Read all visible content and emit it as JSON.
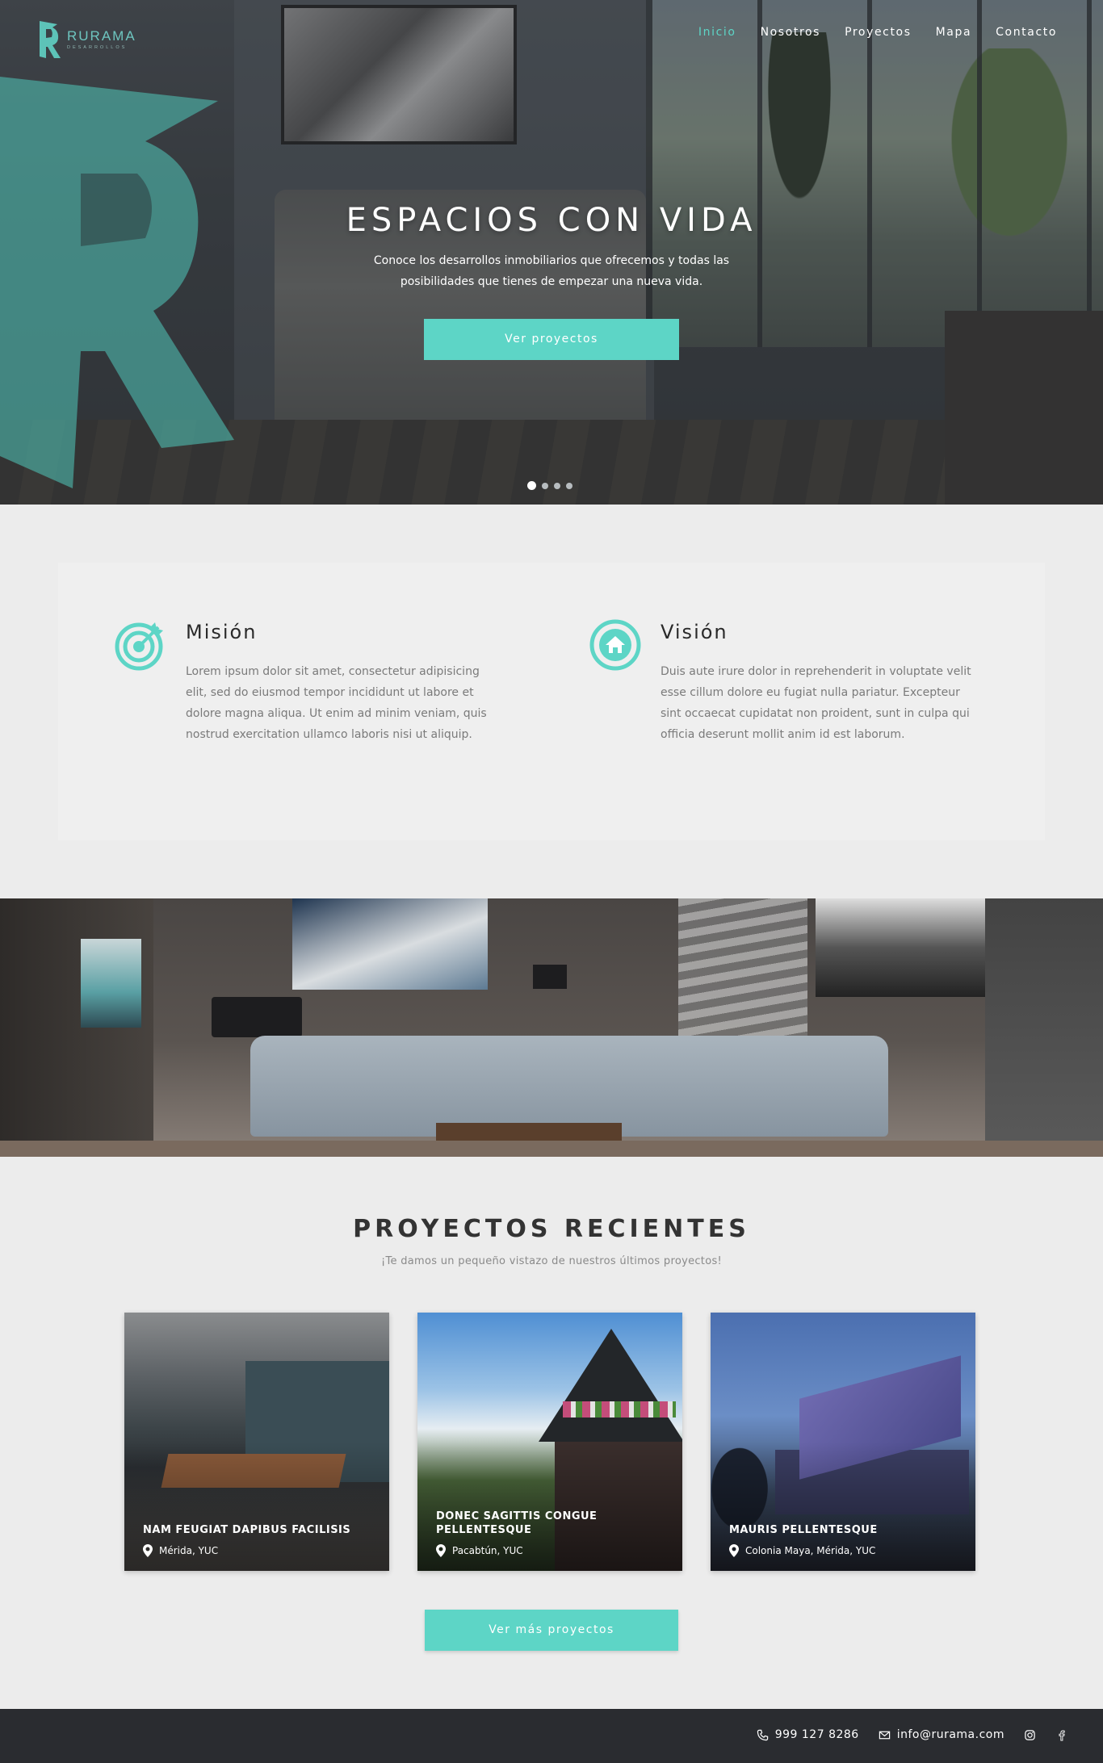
{
  "brand": {
    "name": "RURAMA",
    "tagline": "DESARROLLOS"
  },
  "nav": [
    {
      "label": "Inicio",
      "active": true
    },
    {
      "label": "Nosotros",
      "active": false
    },
    {
      "label": "Proyectos",
      "active": false
    },
    {
      "label": "Mapa",
      "active": false
    },
    {
      "label": "Contacto",
      "active": false
    }
  ],
  "hero": {
    "title": "ESPACIOS CON VIDA",
    "subtitle": "Conoce los desarrollos inmobiliarios que ofrecemos y todas las posibilidades que tienes de empezar una nueva vida.",
    "cta": "Ver proyectos",
    "slides": 4,
    "active_slide": 1
  },
  "mission": {
    "title": "Misión",
    "icon": "target-icon",
    "text": "Lorem ipsum dolor sit amet, consectetur adipisicing elit, sed do eiusmod tempor incididunt ut labore et dolore magna aliqua. Ut enim ad minim veniam, quis nostrud exercitation ullamco laboris nisi ut aliquip."
  },
  "vision": {
    "title": "Visión",
    "icon": "home-icon",
    "text": " Duis aute irure dolor in reprehenderit in voluptate velit esse cillum dolore eu fugiat nulla pariatur. Excepteur sint occaecat cupidatat non proident, sunt in culpa qui officia deserunt mollit anim id est laborum."
  },
  "projects": {
    "title": "PROYECTOS RECIENTES",
    "subtitle": "¡Te damos un pequeño vistazo de nuestros últimos proyectos!",
    "items": [
      {
        "name": "NAM FEUGIAT DAPIBUS FACILISIS",
        "location": "Mérida, YUC"
      },
      {
        "name": "DONEC SAGITTIS CONGUE PELLENTESQUE",
        "location": "Pacabtún, YUC"
      },
      {
        "name": "MAURIS PELLENTESQUE",
        "location": "Colonia Maya, Mérida, YUC"
      }
    ],
    "more_cta": "Ver más proyectos"
  },
  "footer": {
    "phone": "999 127 8286",
    "email": "info@rurama.com",
    "social": [
      "instagram-icon",
      "facebook-icon"
    ]
  },
  "colors": {
    "accent": "#5dd5c6",
    "footer": "#2a2c30",
    "background": "#ececec"
  }
}
